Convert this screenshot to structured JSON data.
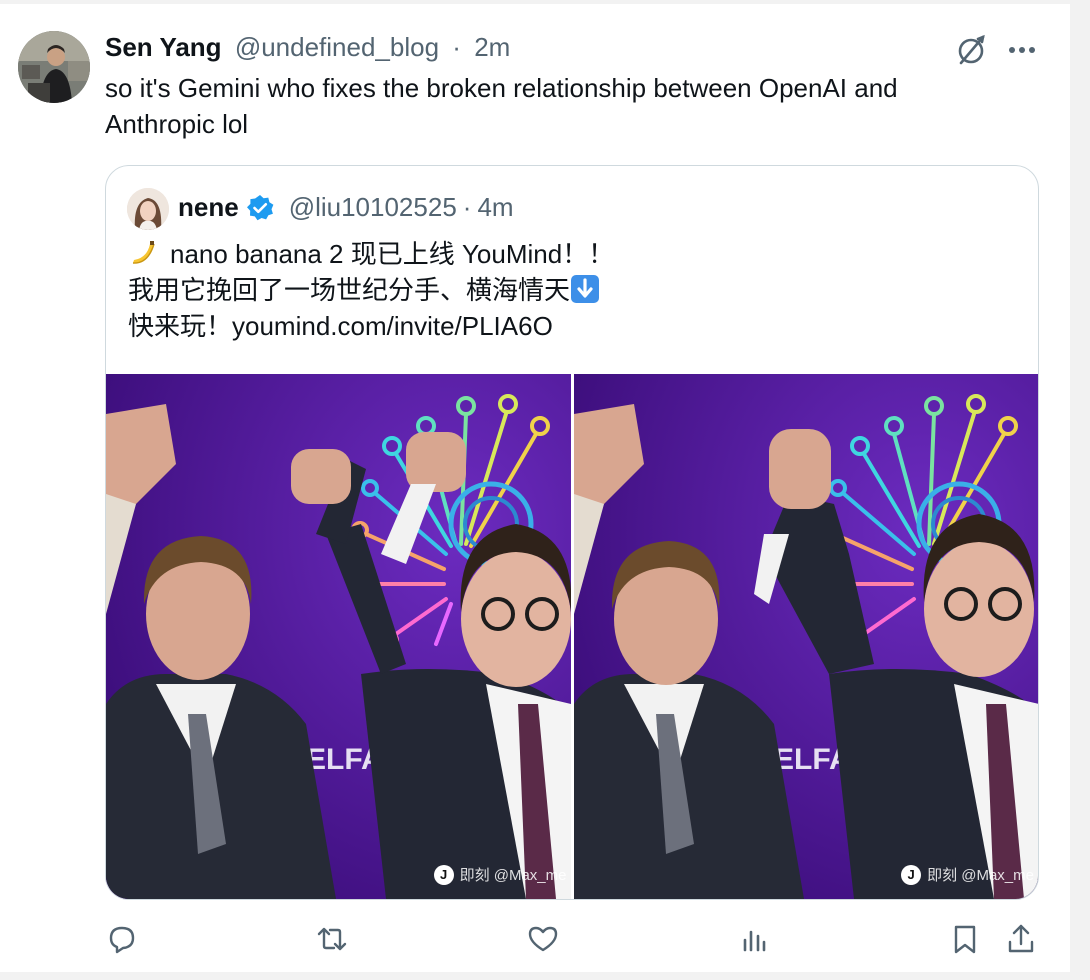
{
  "tweet": {
    "author_name": "Sen Yang",
    "author_handle": "@undefined_blog",
    "separator": "·",
    "time": "2m",
    "text": "so it's Gemini who fixes the broken relationship between OpenAI and Anthropic lol"
  },
  "quoted": {
    "author_name": "nene",
    "author_handle": "@liu10102525",
    "separator": "·",
    "time": "4m",
    "line1": "nano banana 2 现已上线 YouMind！！",
    "line2": "我用它挽回了一场世纪分手、横海情天",
    "line3": "快来玩！youmind.com/invite/PLIA6O",
    "media": [
      {
        "watermark": "即刻 @Max_me",
        "background_text": "ELFA"
      },
      {
        "watermark": "即刻 @Max_me",
        "background_text": "ELFA"
      }
    ]
  },
  "colors": {
    "text_primary": "#0f1419",
    "text_secondary": "#536471",
    "verified_blue": "#1d9bf0",
    "border": "#cfd9de",
    "stage_purple": "#5b1ba8"
  },
  "icons": {
    "grok": "grok-icon",
    "more": "more-icon",
    "verified": "verified-badge-icon",
    "reply": "reply-icon",
    "retweet": "retweet-icon",
    "like": "like-icon",
    "views": "views-icon",
    "bookmark": "bookmark-icon",
    "share": "share-icon"
  }
}
